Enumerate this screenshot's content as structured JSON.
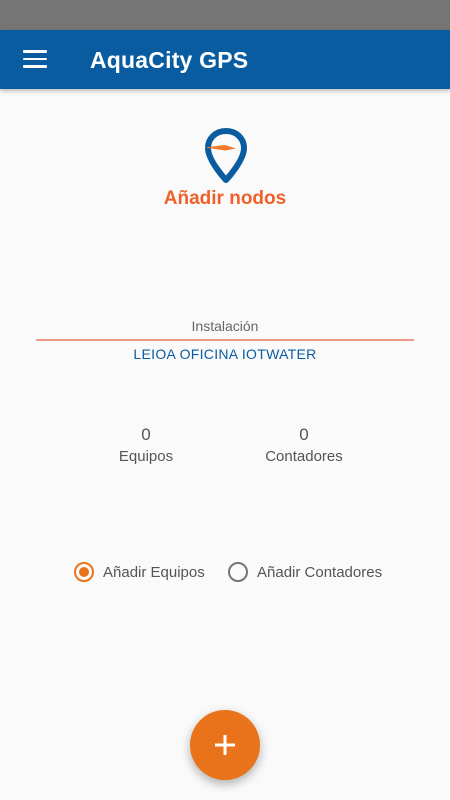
{
  "app_bar": {
    "title": "AquaCity GPS",
    "menu_icon": "hamburger-menu-icon"
  },
  "header": {
    "logo_icon": "map-pin-logo-icon",
    "title": "Añadir nodos"
  },
  "installation": {
    "label": "Instalación",
    "value": "LEIOA OFICINA IOTWATER"
  },
  "stats": {
    "equipos": {
      "count": "0",
      "label": "Equipos"
    },
    "contadores": {
      "count": "0",
      "label": "Contadores"
    }
  },
  "mode_options": {
    "equipos": {
      "label": "Añadir Equipos",
      "selected": true
    },
    "contadores": {
      "label": "Añadir Contadores",
      "selected": false
    }
  },
  "fab": {
    "icon": "plus-icon"
  },
  "colors": {
    "primary": "#0a5ca0",
    "accent": "#e8731b",
    "title": "#f0602a"
  }
}
